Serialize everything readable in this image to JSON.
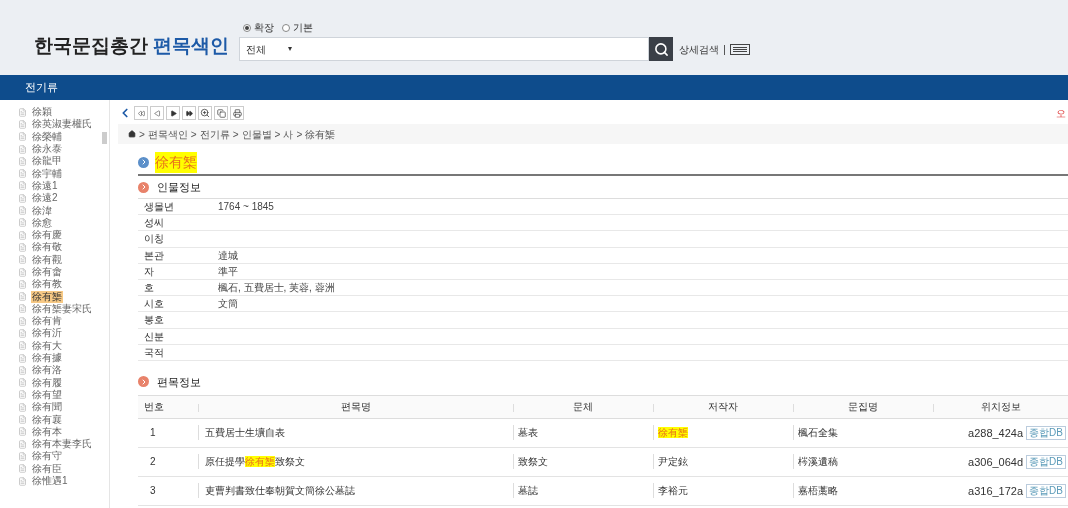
{
  "header": {
    "logo_main": "한국문집총간",
    "logo_accent": "편목색인",
    "search_modes": [
      {
        "label": "확장",
        "selected": true
      },
      {
        "label": "기본",
        "selected": false
      }
    ],
    "scope_select": {
      "value": "전체",
      "caret": "▾"
    },
    "detail_search": "상세검색",
    "separator": "|"
  },
  "nav": {
    "title": "전기류"
  },
  "sidebar": {
    "items": [
      {
        "label": "徐穎",
        "selected": false
      },
      {
        "label": "徐英淑妻權氏",
        "selected": false
      },
      {
        "label": "徐榮輔",
        "selected": false
      },
      {
        "label": "徐永泰",
        "selected": false
      },
      {
        "label": "徐龍甲",
        "selected": false
      },
      {
        "label": "徐宇輔",
        "selected": false
      },
      {
        "label": "徐遠1",
        "selected": false
      },
      {
        "label": "徐遠2",
        "selected": false
      },
      {
        "label": "徐湋",
        "selected": false
      },
      {
        "label": "徐愈",
        "selected": false
      },
      {
        "label": "徐有慶",
        "selected": false
      },
      {
        "label": "徐有敬",
        "selected": false
      },
      {
        "label": "徐有觀",
        "selected": false
      },
      {
        "label": "徐有畬",
        "selected": false
      },
      {
        "label": "徐有教",
        "selected": false
      },
      {
        "label": "徐有榘",
        "selected": true
      },
      {
        "label": "徐有榘妻宋氏",
        "selected": false
      },
      {
        "label": "徐有肯",
        "selected": false
      },
      {
        "label": "徐有沂",
        "selected": false
      },
      {
        "label": "徐有大",
        "selected": false
      },
      {
        "label": "徐有據",
        "selected": false
      },
      {
        "label": "徐有洛",
        "selected": false
      },
      {
        "label": "徐有履",
        "selected": false
      },
      {
        "label": "徐有望",
        "selected": false
      },
      {
        "label": "徐有聞",
        "selected": false
      },
      {
        "label": "徐有襄",
        "selected": false
      },
      {
        "label": "徐有本",
        "selected": false
      },
      {
        "label": "徐有本妻李氏",
        "selected": false
      },
      {
        "label": "徐有守",
        "selected": false
      },
      {
        "label": "徐有臣",
        "selected": false
      },
      {
        "label": "徐惟遇1",
        "selected": false
      }
    ]
  },
  "error_report": "오",
  "breadcrumb_separator": ">",
  "breadcrumb": [
    "편목색인",
    "전기류",
    "인물별",
    "사",
    "徐有榘"
  ],
  "person_name": "徐有榘",
  "person_section": {
    "title": "인물정보",
    "rows": [
      {
        "label": "생몰년",
        "value": "1764 ~ 1845"
      },
      {
        "label": "성씨"
      },
      {
        "label": "이칭"
      },
      {
        "label": "본관",
        "value": "達城"
      },
      {
        "label": "자",
        "value": "準平"
      },
      {
        "label": "호",
        "value": "楓石, 五費居士, 芙蓉, 蓉洲"
      },
      {
        "label": "시호",
        "value": "文簡"
      },
      {
        "label": "봉호"
      },
      {
        "label": "신분"
      },
      {
        "label": "국적"
      }
    ]
  },
  "works_section": {
    "title": "편목정보",
    "columns": [
      "번호",
      "편목명",
      "문체",
      "저작자",
      "문집명",
      "위치정보"
    ],
    "rows": [
      {
        "number": "1",
        "title": [
          {
            "text": "五費居士生壙自表",
            "highlight": false
          }
        ],
        "style": "墓表",
        "author": {
          "text": "徐有榘",
          "highlight": true
        },
        "collection": "楓石全集",
        "location": "a288_424a",
        "db_link": "종합DB"
      },
      {
        "number": "2",
        "title": [
          {
            "text": "原任提學",
            "highlight": false
          },
          {
            "text": "徐有榘",
            "highlight": true
          },
          {
            "text": "致祭文",
            "highlight": false
          }
        ],
        "style": "致祭文",
        "author": {
          "text": "尹定鉉",
          "highlight": false
        },
        "collection": "梣溪遺稿",
        "location": "a306_064d",
        "db_link": "종합DB"
      },
      {
        "number": "3",
        "title": [
          {
            "text": "吏曹判書致仕奉朝賀文簡徐公墓誌",
            "highlight": false
          }
        ],
        "style": "墓誌",
        "author": {
          "text": "李裕元",
          "highlight": false
        },
        "collection": "嘉梧藁略",
        "location": "a316_172a",
        "db_link": "종합DB"
      }
    ]
  }
}
